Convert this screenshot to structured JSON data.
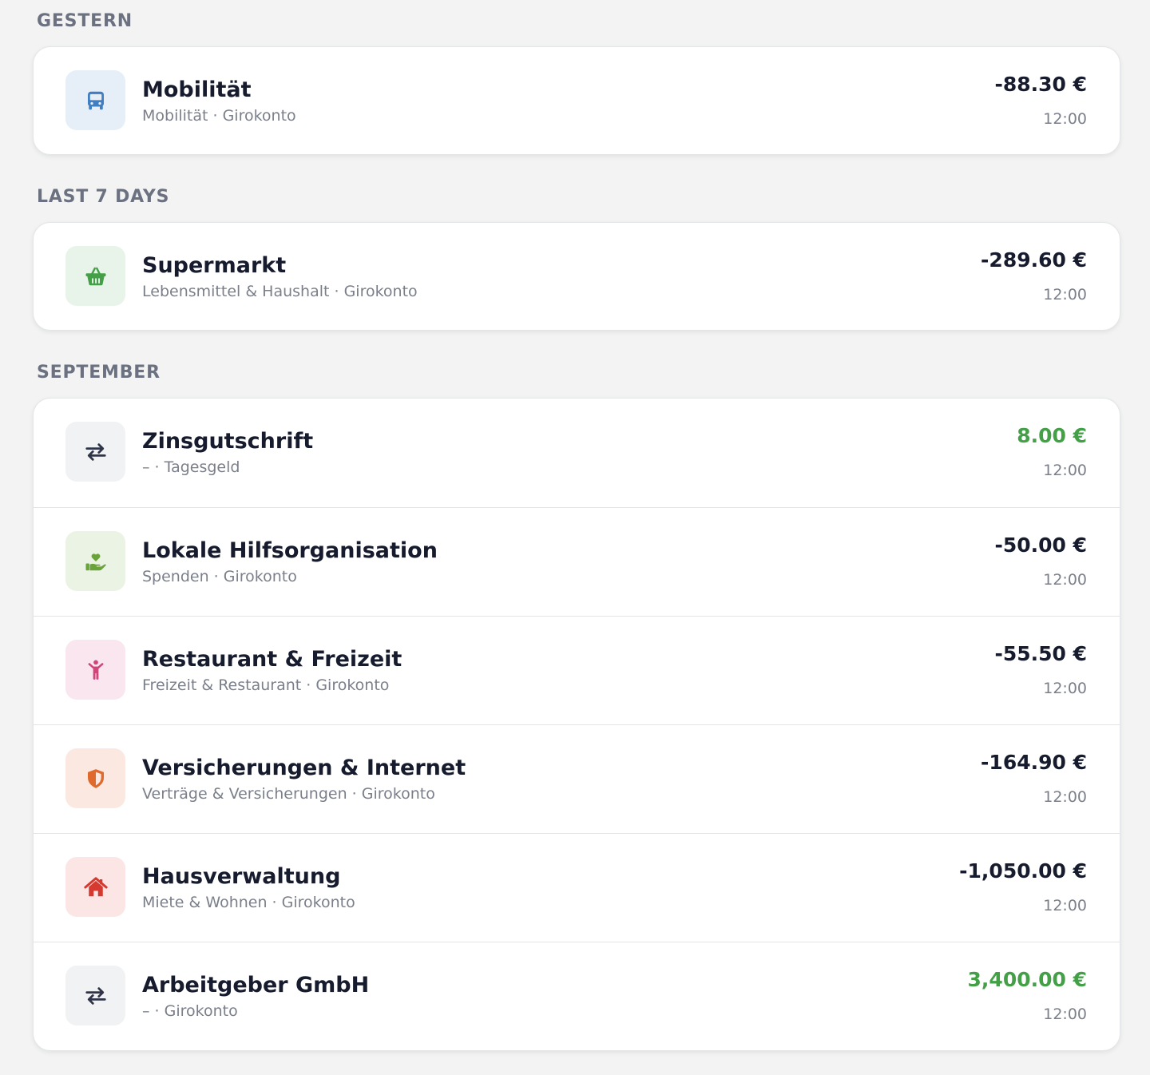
{
  "sections": [
    {
      "title": "GESTERN",
      "transactions": [
        {
          "name": "Mobilität",
          "subtitle": "Mobilität · Girokonto",
          "amount": "-88.30 €",
          "time": "12:00",
          "icon": "bus-icon",
          "icon_color": "#3f7fc1",
          "icon_bg": "#e6eef8"
        }
      ]
    },
    {
      "title": "LAST 7 DAYS",
      "transactions": [
        {
          "name": "Supermarkt",
          "subtitle": "Lebensmittel & Haushalt · Girokonto",
          "amount": "-289.60 €",
          "time": "12:00",
          "icon": "shopping-basket-icon",
          "icon_color": "#43a047",
          "icon_bg": "#e8f3ea"
        }
      ]
    },
    {
      "title": "SEPTEMBER",
      "transactions": [
        {
          "name": "Zinsgutschrift",
          "subtitle": "– · Tagesgeld",
          "amount": "8.00 €",
          "time": "12:00",
          "icon": "transfer-arrows-icon",
          "icon_color": "#2f3448",
          "icon_bg": "#f1f2f4"
        },
        {
          "name": "Lokale Hilfsorganisation",
          "subtitle": "Spenden · Girokonto",
          "amount": "-50.00 €",
          "time": "12:00",
          "icon": "hand-heart-icon",
          "icon_color": "#6aa33a",
          "icon_bg": "#ebf3e4"
        },
        {
          "name": "Restaurant & Freizeit",
          "subtitle": "Freizeit & Restaurant · Girokonto",
          "amount": "-55.50 €",
          "time": "12:00",
          "icon": "person-icon",
          "icon_color": "#d0457a",
          "icon_bg": "#f9e6ee"
        },
        {
          "name": "Versicherungen & Internet",
          "subtitle": "Verträge & Versicherungen · Girokonto",
          "amount": "-164.90 €",
          "time": "12:00",
          "icon": "shield-icon",
          "icon_color": "#e06a2c",
          "icon_bg": "#fbe9e1"
        },
        {
          "name": "Hausverwaltung",
          "subtitle": "Miete & Wohnen · Girokonto",
          "amount": "-1,050.00 €",
          "time": "12:00",
          "icon": "house-icon",
          "icon_color": "#d6392f",
          "icon_bg": "#fbe6e5"
        },
        {
          "name": "Arbeitgeber GmbH",
          "subtitle": "– · Girokonto",
          "amount": "3,400.00 €",
          "time": "12:00",
          "icon": "transfer-arrows-icon",
          "icon_color": "#2f3448",
          "icon_bg": "#f1f2f4"
        }
      ]
    }
  ],
  "colors": {
    "positive": "#43a047",
    "negative": "#171b2e"
  }
}
